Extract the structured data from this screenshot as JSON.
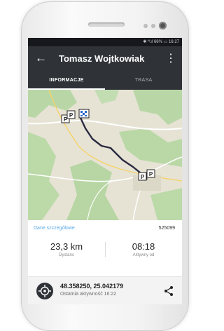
{
  "status_bar": {
    "text": "✱ ᴴ.ıl 66% ▭ 16:27"
  },
  "app_bar": {
    "back_icon": "arrow-left-icon",
    "title": "Tomasz Wojtkowiak",
    "menu_icon": "more-vertical-icon"
  },
  "tabs": [
    {
      "label": "INFORMACJE",
      "active": true
    },
    {
      "label": "TRASA",
      "active": false
    }
  ],
  "map": {
    "markers": [
      "parking",
      "parking",
      "flag",
      "parking",
      "parking"
    ],
    "route_color": "#2b2940"
  },
  "details": {
    "link_label": "Dane szczegółowe",
    "id": "525099",
    "distance_value": "23,3 km",
    "distance_label": "Dystans",
    "active_value": "08:18",
    "active_label": "Aktywny od"
  },
  "location": {
    "coords": "48.358250, 25.042179",
    "last_seen": "Ostatnia aktywność 16:22",
    "share_icon": "share-icon"
  },
  "colors": {
    "appbar": "#2f3338",
    "accent_link": "#55a7e8"
  }
}
